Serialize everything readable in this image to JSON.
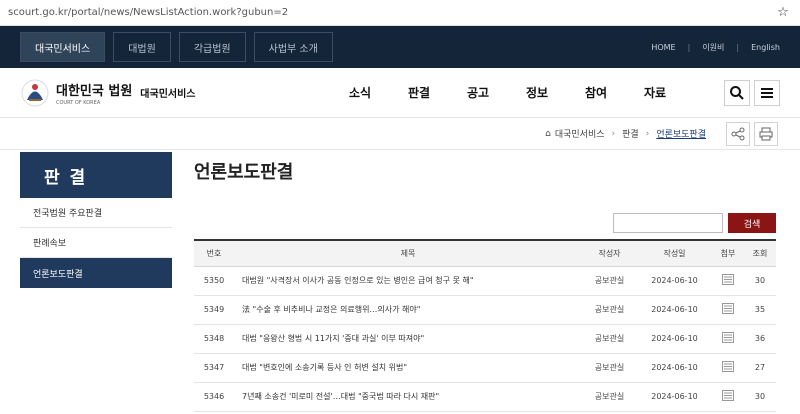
{
  "browser": {
    "url": "scourt.go.kr/portal/news/NewsListAction.work?gubun=2",
    "star_icon": "star-icon"
  },
  "topnav": {
    "tabs": [
      "대국민서비스",
      "대법원",
      "각급법원",
      "사법부 소개"
    ],
    "active_tab": 0,
    "util": [
      "HOME",
      "이원비",
      "English"
    ]
  },
  "header": {
    "court_ko": "대한민국 법원",
    "court_en": "COURT OF KOREA",
    "service": "대국민서비스",
    "menu": [
      "소식",
      "판결",
      "공고",
      "정보",
      "참여",
      "자료"
    ],
    "icons": [
      "search-icon",
      "menu-icon"
    ]
  },
  "breadcrumb": {
    "items": [
      "대국민서비스",
      "판결",
      "언론보도판결"
    ],
    "tools": [
      "share-icon",
      "print-icon"
    ]
  },
  "lnb": {
    "title": "판 결",
    "items": [
      "전국법원 주요판결",
      "판례속보",
      "언론보도판결"
    ],
    "active_index": 2
  },
  "page": {
    "title": "언론보도판결",
    "search_placeholder": "",
    "search_label": "검색"
  },
  "table": {
    "headers": [
      "번호",
      "제목",
      "작성자",
      "작성일",
      "첨부",
      "조회"
    ],
    "rows": [
      {
        "no": "5350",
        "title": "대법원 \"사격장서 이사가 공동 인정으로 있는 병인은 급여 청구 못 해\"",
        "author": "공보관실",
        "date": "2024-06-10",
        "views": "30"
      },
      {
        "no": "5349",
        "title": "法 \"수술 후 비추비나 교정은 의료행위…의사가 해야\"",
        "author": "공보관실",
        "date": "2024-06-10",
        "views": "35"
      },
      {
        "no": "5348",
        "title": "대법 \"응왕산 형법 시 11가지 '중대 과실' 이부 따져야\"",
        "author": "공보관실",
        "date": "2024-06-10",
        "views": "36"
      },
      {
        "no": "5347",
        "title": "대법 \"변호인에 소송기록 등사 인 허변 설치 위법\"",
        "author": "공보관실",
        "date": "2024-06-10",
        "views": "27"
      },
      {
        "no": "5346",
        "title": "7년째 소송건 '미로미 전설'…대법 \"중국법 따라 다시 재판\"",
        "author": "공보관실",
        "date": "2024-06-10",
        "views": "30"
      }
    ]
  },
  "colors": {
    "navy": "#14253a",
    "lnb_navy": "#203a5e",
    "search_red": "#8b1414"
  }
}
